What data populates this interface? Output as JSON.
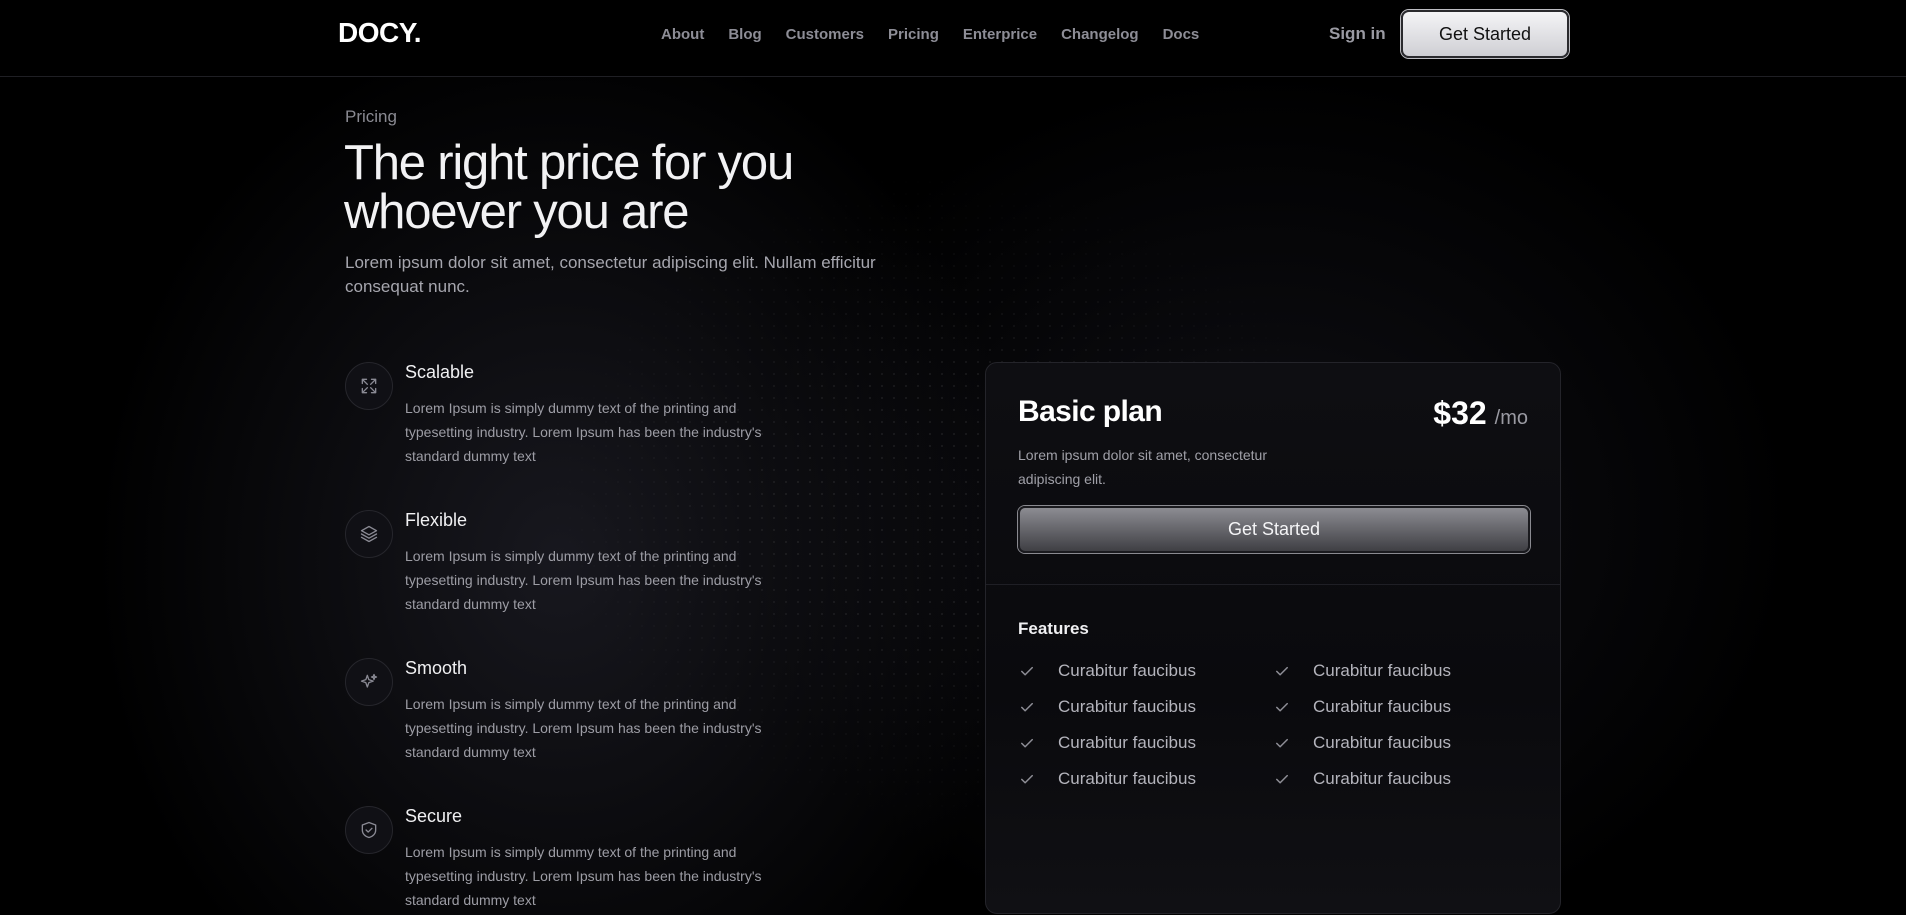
{
  "nav": {
    "logo": "DOCY.",
    "links": [
      "About",
      "Blog",
      "Customers",
      "Pricing",
      "Enterprice",
      "Changelog",
      "Docs"
    ],
    "signin": "Sign in",
    "cta": "Get Started"
  },
  "hero": {
    "eyebrow": "Pricing",
    "headline": "The right price for you whoever you are",
    "lead": "Lorem ipsum dolor sit amet, consectetur adipiscing elit. Nullam efficitur consequat nunc."
  },
  "features": [
    {
      "title": "Scalable",
      "icon": "expand-icon",
      "desc": "Lorem Ipsum is simply dummy text of the printing and typesetting industry. Lorem Ipsum has been the industry's standard dummy text"
    },
    {
      "title": "Flexible",
      "icon": "layers-icon",
      "desc": "Lorem Ipsum is simply dummy text of the printing and typesetting industry. Lorem Ipsum has been the industry's standard dummy text"
    },
    {
      "title": "Smooth",
      "icon": "sparkles-icon",
      "desc": "Lorem Ipsum is simply dummy text of the printing and typesetting industry. Lorem Ipsum has been the industry's standard dummy text"
    },
    {
      "title": "Secure",
      "icon": "shield-check-icon",
      "desc": "Lorem Ipsum is simply dummy text of the printing and typesetting industry. Lorem Ipsum has been the industry's standard dummy text"
    }
  ],
  "plan": {
    "name": "Basic plan",
    "price": "$32",
    "unit": "/mo",
    "desc": "Lorem ipsum dolor sit amet, consectetur adipiscing elit.",
    "cta": "Get Started",
    "features_title": "Features",
    "feature_items": [
      "Curabitur faucibus",
      "Curabitur faucibus",
      "Curabitur faucibus",
      "Curabitur faucibus",
      "Curabitur faucibus",
      "Curabitur faucibus",
      "Curabitur faucibus",
      "Curabitur faucibus"
    ]
  },
  "colors": {
    "background": "#000000",
    "card": "#0e0e12",
    "text_muted": "#9d9da5"
  }
}
